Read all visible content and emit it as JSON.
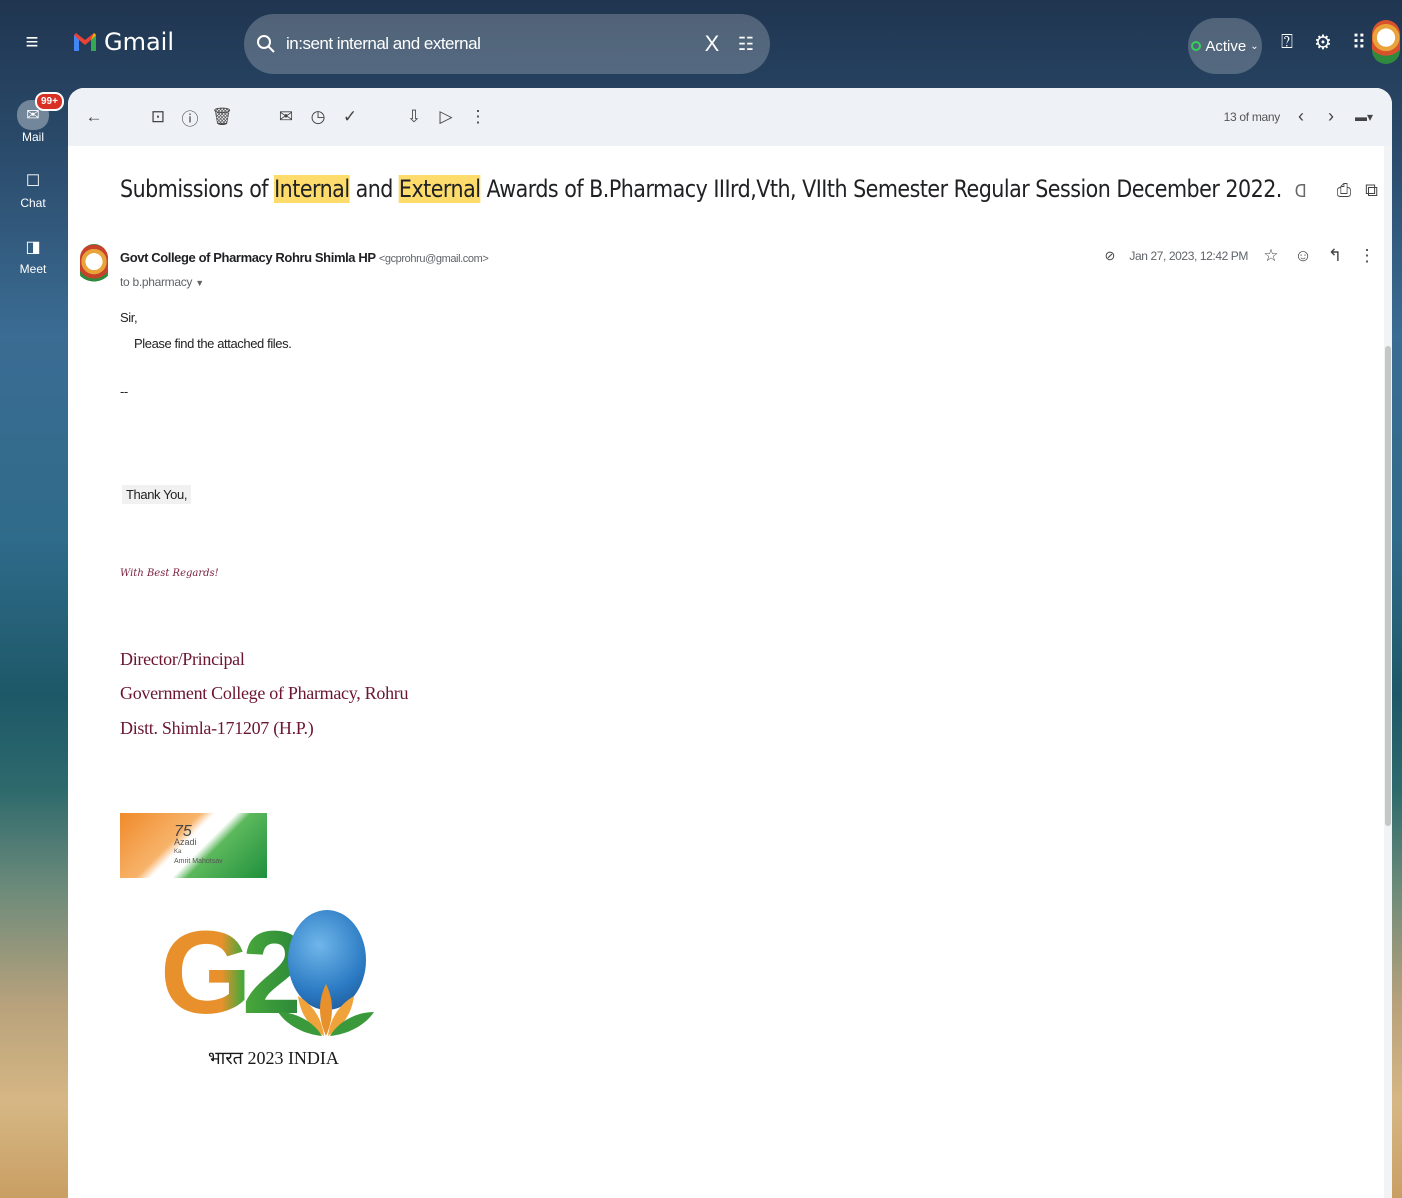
{
  "app": {
    "name": "Gmail"
  },
  "search": {
    "query": "in:sent internal and external",
    "clear_label": "X"
  },
  "status": {
    "label": "Active"
  },
  "rail": {
    "mail_badge": "99+",
    "items": [
      {
        "label": "Mail",
        "icon": "mail-icon"
      },
      {
        "label": "Chat",
        "icon": "chat-icon"
      },
      {
        "label": "Meet",
        "icon": "meet-icon"
      }
    ]
  },
  "toolbar": {
    "count": "13 of many"
  },
  "email": {
    "subject_parts": {
      "part1": "Submissions of ",
      "highlight1": "Internal",
      "part2": " and ",
      "highlight2": "External",
      "part3": " Awards of B.Pharmacy IIIrd,Vth, VIIth Semester Regular Session December 2022."
    },
    "sender_name": "Govt College of Pharmacy Rohru Shimla HP",
    "sender_email": "<gcprohru@gmail.com>",
    "to_line": "to b.pharmacy",
    "date": "Jan 27, 2023, 12:42 PM",
    "body": {
      "greeting": "Sir,",
      "line1": "Please find the attached files.",
      "dash": "--",
      "thanks": "Thank You,",
      "regards": "With Best Regards!",
      "sig1": "Director/Principal",
      "sig2": "Government College of Pharmacy, Rohru",
      "sig3": "Distt. Shimla-171207 (H.P.)"
    },
    "logo_azadi": {
      "number": "75",
      "line1": "Azadi",
      "line2": "Ka",
      "line3": "Amrit Mahotsav"
    },
    "logo_g20": {
      "text": "G20",
      "caption": "भारत 2023 INDIA"
    }
  },
  "colors": {
    "highlight": "#fddc6c",
    "signature": "#6b1530",
    "badge": "#d93025",
    "active_dot": "#34d058"
  }
}
